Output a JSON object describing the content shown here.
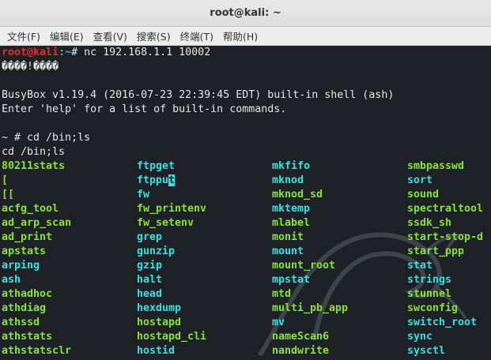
{
  "window": {
    "title": "root@kali: ~"
  },
  "menu": [
    {
      "label": "文件(F)"
    },
    {
      "label": "编辑(E)"
    },
    {
      "label": "查看(V)"
    },
    {
      "label": "搜索(S)"
    },
    {
      "label": "终端(T)"
    },
    {
      "label": "帮助(H)"
    }
  ],
  "terminal": {
    "prompt_user": "root@kali",
    "prompt_path": ":~",
    "prompt_cmd": "# nc 192.168.1.1 10002",
    "garbled": "����!����",
    "busybox_line": "BusyBox v1.19.4 (2016-07-23 22:39:45 EDT) built-in shell (ash)",
    "help_line": "Enter 'help' for a list of built-in commands.",
    "ash_prompt": "~ # cd /bin;ls",
    "echo_line": "cd /bin;ls"
  },
  "listing": {
    "columns": [
      [
        "80211stats",
        "[",
        "[[",
        "acfg_tool",
        "ad_arp_scan",
        "ad_print",
        "apstats",
        "arping",
        "ash",
        "athadhoc",
        "athdiag",
        "athssd",
        "athstats",
        "athstatsclr"
      ],
      [
        "ftpget",
        "ftpput",
        "fw",
        "fw_printenv",
        "fw_setenv",
        "grep",
        "gunzip",
        "gzip",
        "halt",
        "head",
        "hexdump",
        "hostapd",
        "hostapd_cli",
        "hostid"
      ],
      [
        "mkfifo",
        "mknod",
        "mknod_sd",
        "mktemp",
        "mlabel",
        "monit",
        "mount",
        "mount_root",
        "mpstat",
        "mtd",
        "multi_pb_app",
        "mv",
        "nameScan6",
        "nandwrite"
      ],
      [
        "smbpasswd",
        "sort",
        "sound",
        "spectraltool",
        "ssdk_sh",
        "start-stop-d",
        "start_ppp",
        "stat",
        "strings",
        "stunnel",
        "swconfig",
        "switch_root",
        "sync",
        "sysctl"
      ]
    ],
    "types": [
      [
        "exec",
        "exec",
        "exec",
        "exec",
        "exec",
        "exec",
        "exec",
        "link",
        "link",
        "exec",
        "exec",
        "exec",
        "exec",
        "exec"
      ],
      [
        "link",
        "link",
        "link",
        "exec",
        "exec",
        "link",
        "link",
        "link",
        "link",
        "link",
        "link",
        "exec",
        "exec",
        "link"
      ],
      [
        "link",
        "link",
        "exec",
        "link",
        "exec",
        "exec",
        "link",
        "exec",
        "link",
        "exec",
        "exec",
        "link",
        "exec",
        "exec"
      ],
      [
        "exec",
        "link",
        "exec",
        "exec",
        "exec",
        "exec",
        "exec",
        "link",
        "link",
        "exec",
        "exec",
        "link",
        "link",
        "link"
      ]
    ],
    "colors": {
      "exec": "#8ae234",
      "link": "#34e2e2"
    }
  }
}
